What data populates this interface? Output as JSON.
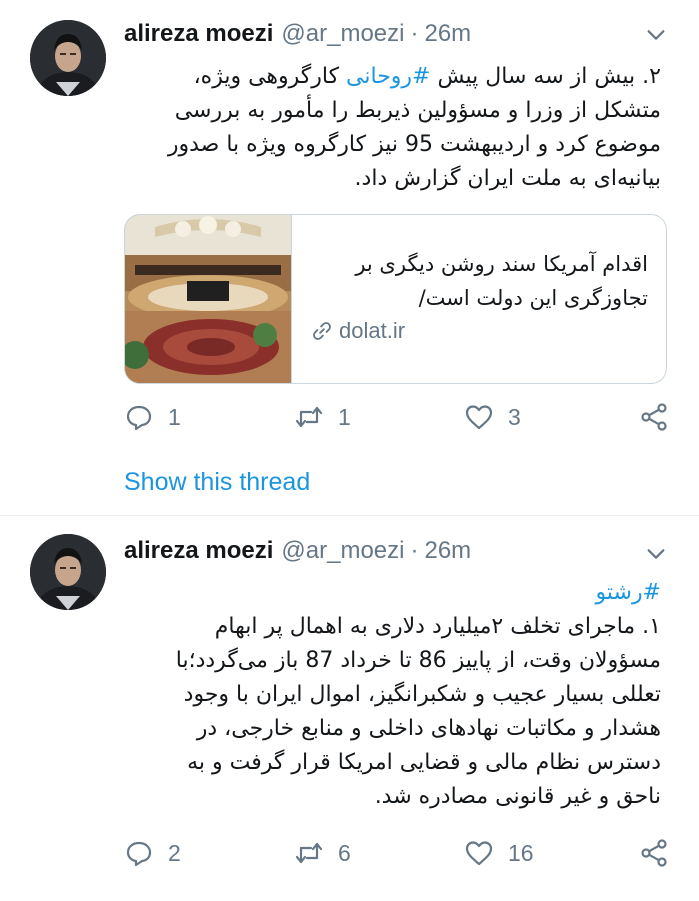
{
  "tweets": [
    {
      "author": {
        "name": "alireza moezi",
        "handle": "@ar_moezi",
        "separator": "·",
        "time": "26m"
      },
      "text_lines": [
        "۲. بیش از سه سال پیش #روحانی کارگروهی ویژه،",
        "متشکل از وزرا و مسؤولین ذیربط را مأمور به بررسی",
        "موضوع کرد و اردیبهشت 95 نیز کارگروه ویژه با صدور",
        "بیانیه‌ای به ملت ایران گزارش داد."
      ],
      "hashtag": "#روحانی",
      "card": {
        "title_lines": [
          "اقدام آمریکا سند روشن دیگری بر",
          "تجاوزگری این دولت است/"
        ],
        "domain": "dolat.ir"
      },
      "actions": {
        "reply_count": "1",
        "retweet_count": "1",
        "like_count": "3"
      },
      "show_thread": "Show this thread"
    },
    {
      "author": {
        "name": "alireza moezi",
        "handle": "@ar_moezi",
        "separator": "·",
        "time": "26m"
      },
      "hashtag_line": "#رشتو",
      "text_lines": [
        "۱. ماجرای تخلف ۲میلیارد دلاری به اهمال پر ابهام",
        "مسؤولان وقت، از پاییز 86 تا خرداد 87 باز می‌گردد؛با",
        "تعللی بسیار عجیب و شکبرانگیز، اموال ایران با وجود",
        "هشدار و مکاتبات نهادهای داخلی و منابع خارجی، در",
        "دسترس نظام مالی و قضایی امریکا قرار گرفت و به",
        "ناحق و غیر قانونی مصادره شد."
      ],
      "actions": {
        "reply_count": "2",
        "retweet_count": "6",
        "like_count": "16"
      }
    }
  ],
  "icons": {
    "reply": "reply-icon",
    "retweet": "retweet-icon",
    "like": "heart-icon",
    "share": "share-icon",
    "more": "chevron-down-icon",
    "link": "link-icon"
  },
  "colors": {
    "link_blue": "#1b95e0",
    "muted": "#657786",
    "text": "#14171a",
    "border": "#ccd6dd"
  }
}
